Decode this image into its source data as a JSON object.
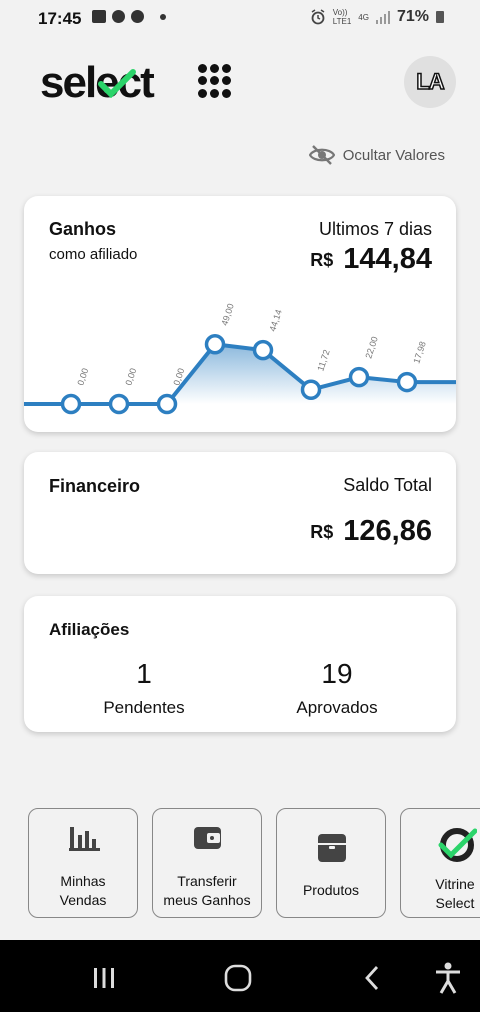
{
  "status": {
    "time": "17:45",
    "network_top": "Vo))",
    "network_bottom": "LTE1",
    "network_type": "4G",
    "battery": "71%"
  },
  "header": {
    "logo_text": "select",
    "avatar_initials": "LA",
    "icons": [
      "apps-grid-icon",
      "avatar"
    ]
  },
  "hide_values": {
    "label": "Ocultar Valores",
    "icon": "eye-off-icon"
  },
  "earnings": {
    "title": "Ganhos",
    "subtitle": "como afiliado",
    "period": "Ultimos 7 dias",
    "currency": "R$",
    "total": "144,84",
    "accent_color": "#2d7fc1"
  },
  "chart_data": {
    "type": "area",
    "values": [
      0.0,
      0.0,
      0.0,
      49.0,
      44.14,
      11.72,
      22.0,
      17.98
    ],
    "labels": [
      "0,00",
      "0,00",
      "0,00",
      "49,00",
      "44,14",
      "11,72",
      "22,00",
      "17,98"
    ],
    "ylim": [
      0,
      70
    ],
    "grid": false,
    "color": "#2d7fc1"
  },
  "financeiro": {
    "title": "Financeiro",
    "balance_label": "Saldo Total",
    "currency": "R$",
    "balance": "126,86"
  },
  "afiliacoes": {
    "title": "Afiliações",
    "pending_count": "1",
    "pending_label": "Pendentes",
    "approved_count": "19",
    "approved_label": "Aprovados"
  },
  "shortcuts": [
    {
      "line1": "Minhas",
      "line2": "Vendas",
      "icon": "bar-chart-icon"
    },
    {
      "line1": "Transferir",
      "line2": "meus Ganhos",
      "icon": "wallet-icon"
    },
    {
      "line1": "Produtos",
      "line2": "",
      "icon": "box-icon"
    },
    {
      "line1": "Vitrine",
      "line2": "Select",
      "icon": "select-logo-icon"
    }
  ],
  "navbar": {
    "icons": [
      "recent-apps-icon",
      "home-icon",
      "back-icon",
      "accessibility-icon"
    ]
  }
}
